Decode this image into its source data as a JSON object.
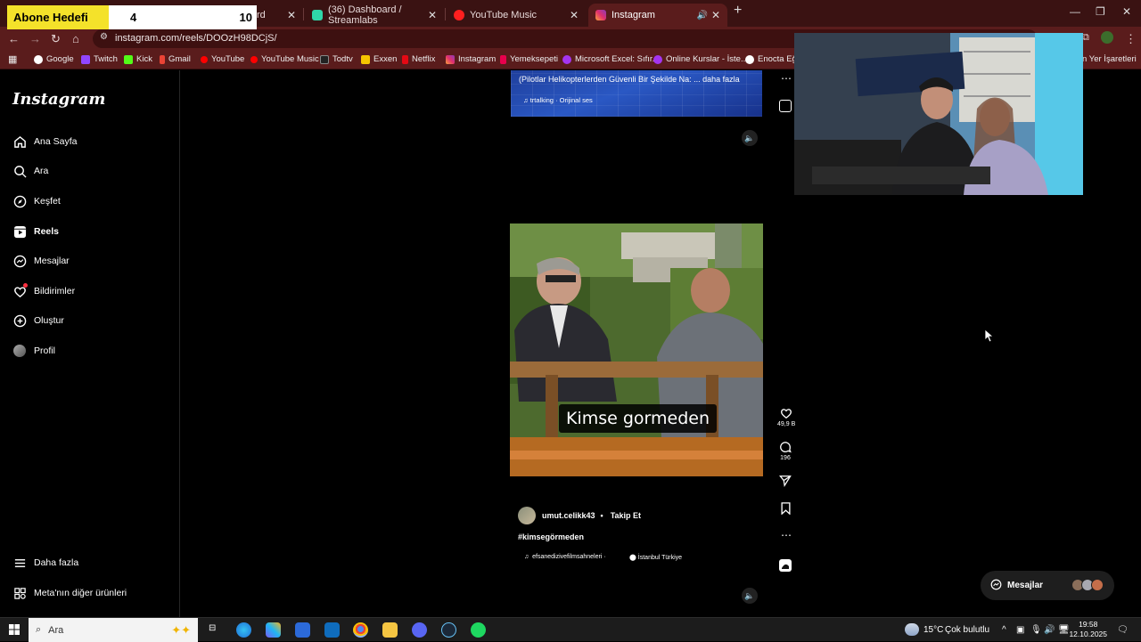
{
  "overlay": {
    "label": "Abone Hedefi",
    "current": "4",
    "goal": "10"
  },
  "browser": {
    "tabs": [
      {
        "label": "rd"
      },
      {
        "label": "(36) Dashboard / Streamlabs"
      },
      {
        "label": "YouTube Music"
      },
      {
        "label": "Instagram",
        "active": true
      }
    ],
    "url": "instagram.com/reels/DOOzH98DCjS/",
    "bookmarks": [
      "Google",
      "Twitch",
      "Kick",
      "Gmail",
      "YouTube",
      "YouTube Music",
      "Todtv",
      "Exxen",
      "Netflix",
      "Instagram",
      "Yemeksepeti",
      "Microsoft Excel: Sıfır...",
      "Online Kurslar - İste...",
      "Enocta Eğiti",
      "n Yer İşaretleri"
    ]
  },
  "sidebar": {
    "logo": "Instagram",
    "items": [
      {
        "label": "Ana Sayfa",
        "icon": "home-icon"
      },
      {
        "label": "Ara",
        "icon": "search-icon"
      },
      {
        "label": "Keşfet",
        "icon": "compass-icon"
      },
      {
        "label": "Reels",
        "icon": "reels-icon"
      },
      {
        "label": "Mesajlar",
        "icon": "messenger-icon"
      },
      {
        "label": "Bildirimler",
        "icon": "heart-icon"
      },
      {
        "label": "Oluştur",
        "icon": "plus-icon"
      },
      {
        "label": "Profil",
        "icon": "avatar-icon"
      }
    ],
    "more": "Daha fazla",
    "meta": "Meta'nın diğer ürünleri"
  },
  "prev_reel": {
    "caption": "(Pilotlar Helikopterlerden Güvenli Bir Şekilde Na: ... daha fazla",
    "audio": "trtalking · Orijinal ses"
  },
  "reel": {
    "subtitle": "Kimse gormeden",
    "likes": "49,9 B",
    "comments": "196",
    "username": "umut.celikk43",
    "follow": "Takip Et",
    "hashtag": "#kimsegörmeden",
    "audio": "efsanedizivefilmsahneleri ·",
    "location": "İstanbul Türkiye"
  },
  "messages_pill": {
    "label": "Mesajlar"
  },
  "taskbar": {
    "search": "Ara",
    "weather": "15°C",
    "weather_text": "Çok bulutlu",
    "time": "19:58",
    "date": "12.10.2025"
  },
  "colors": {
    "tab_strip": "#3a1212",
    "toolbar": "#5a1c1c",
    "abone_yellow": "#f4e22a"
  }
}
